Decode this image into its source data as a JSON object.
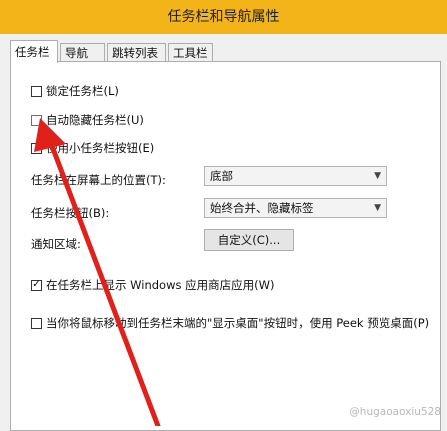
{
  "window": {
    "title": "任务栏和导航属性"
  },
  "tabs": [
    "任务栏",
    "导航",
    "跳转列表",
    "工具栏"
  ],
  "taskbar": {
    "lock_taskbar": {
      "label": "锁定任务栏(L)",
      "checked": false
    },
    "auto_hide": {
      "label": "自动隐藏任务栏(U)",
      "checked": false
    },
    "small_buttons": {
      "label": "使用小任务栏按钮(E)",
      "checked": false
    },
    "location": {
      "label": "任务栏在屏幕上的位置(T):",
      "value": "底部"
    },
    "buttons": {
      "label": "任务栏按钮(B):",
      "value": "始终合并、隐藏标签"
    },
    "notification_area": {
      "label": "通知区域:",
      "button_label": "自定义(C)..."
    },
    "show_store_apps": {
      "label": "在任务栏上显示 Windows 应用商店应用(W)",
      "checked": true
    },
    "peek": {
      "label": "当你将鼠标移动到任务栏末端的\"显示桌面\"按钮时，使用 Peek 预览桌面(P)",
      "checked": false
    }
  },
  "icons": {
    "checkmark": "✓",
    "dropdown": "▼"
  },
  "colors": {
    "titlebar": "#f2b418",
    "arrow": "#e0201b"
  },
  "watermark": "@hugaoaoxiu528"
}
